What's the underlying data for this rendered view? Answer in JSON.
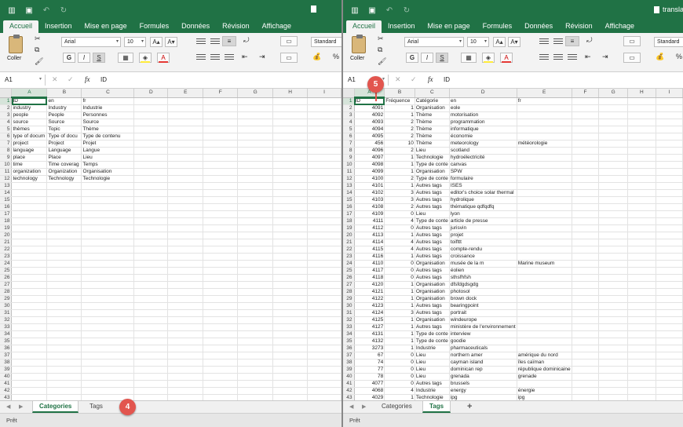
{
  "left": {
    "title": "",
    "tabs": [
      "Accueil",
      "Insertion",
      "Mise en page",
      "Formules",
      "Données",
      "Révision",
      "Affichage"
    ],
    "ribbon": {
      "paste_label": "Coller",
      "font": "Arial",
      "size": "10",
      "bold": "G",
      "italic": "I",
      "underline": "S"
    },
    "namebox": "A1",
    "formula": "ID",
    "columns": [
      "A",
      "B",
      "C",
      "D",
      "E",
      "F",
      "G",
      "H",
      "I"
    ],
    "rows": [
      [
        "ID",
        "en",
        "fr"
      ],
      [
        "industry",
        "Industry",
        "Industrie"
      ],
      [
        "people",
        "People",
        "Personnes"
      ],
      [
        "source",
        "Source",
        "Source"
      ],
      [
        "thèmes",
        "Topic",
        "Thème"
      ],
      [
        "type of docum",
        "Type of docu",
        "Type de contenu"
      ],
      [
        "project",
        "Project",
        "Projet"
      ],
      [
        "language",
        "Language",
        "Langue"
      ],
      [
        "place",
        "Place",
        "Lieu"
      ],
      [
        "time",
        "Time coverag",
        "Temps"
      ],
      [
        "organization",
        "Organization",
        "Organisation"
      ],
      [
        "technology",
        "Technology",
        "Technologie"
      ]
    ],
    "sheets": [
      "Categories",
      "Tags"
    ],
    "active_sheet": 0,
    "status": "Prêt",
    "callout": "4"
  },
  "right": {
    "title": "transla",
    "tabs": [
      "Accueil",
      "Insertion",
      "Mise en page",
      "Formules",
      "Données",
      "Révision",
      "Affichage"
    ],
    "ribbon": {
      "paste_label": "Coller",
      "font": "Arial",
      "size": "10",
      "bold": "G",
      "italic": "I",
      "underline": "S",
      "number_format": "Standard"
    },
    "namebox": "A1",
    "formula": "ID",
    "columns": [
      "A",
      "B",
      "C",
      "D",
      "E",
      "F",
      "G",
      "H",
      "I"
    ],
    "rows": [
      [
        "ID",
        "Fréquence",
        "Catégorie",
        "en",
        "fr"
      ],
      [
        "4091",
        "1",
        "Organisation",
        "eole",
        ""
      ],
      [
        "4092",
        "1",
        "Thème",
        "motorisation",
        ""
      ],
      [
        "4093",
        "2",
        "Thème",
        "programmation",
        ""
      ],
      [
        "4094",
        "2",
        "Thème",
        "informatique",
        ""
      ],
      [
        "4095",
        "2",
        "Thème",
        "économie",
        ""
      ],
      [
        "456",
        "10",
        "Thème",
        "meteorology",
        "météorologie"
      ],
      [
        "4096",
        "2",
        "Lieu",
        "scotland",
        ""
      ],
      [
        "4097",
        "1",
        "Technologie",
        "hydroélectricité",
        ""
      ],
      [
        "4098",
        "1",
        "Type de conte",
        "canvas",
        ""
      ],
      [
        "4099",
        "1",
        "Organisation",
        "SPW",
        ""
      ],
      [
        "4100",
        "2",
        "Type de conte",
        "formulaire",
        ""
      ],
      [
        "4101",
        "1",
        "Autres tags",
        "ISES",
        ""
      ],
      [
        "4102",
        "3",
        "Autres tags",
        "editor's choice solar thermal",
        ""
      ],
      [
        "4103",
        "3",
        "Autres tags",
        "hydrolique",
        ""
      ],
      [
        "4108",
        "2",
        "Autres tags",
        "thématique qdfqdfq",
        ""
      ],
      [
        "4109",
        "0",
        "Lieu",
        "lyon",
        ""
      ],
      [
        "4111",
        "4",
        "Type de conte",
        "article de presse",
        ""
      ],
      [
        "4112",
        "0",
        "Autres tags",
        "jurisvin",
        ""
      ],
      [
        "4113",
        "1",
        "Autres tags",
        "projet",
        ""
      ],
      [
        "4114",
        "4",
        "Autres tags",
        "toifttt",
        ""
      ],
      [
        "4115",
        "4",
        "Autres tags",
        "compte-rendu",
        ""
      ],
      [
        "4116",
        "1",
        "Autres tags",
        "croissance",
        ""
      ],
      [
        "4110",
        "0",
        "Organisation",
        "musée de la m",
        "Marine museum"
      ],
      [
        "4117",
        "0",
        "Autres tags",
        "éolien",
        ""
      ],
      [
        "4118",
        "0",
        "Autres tags",
        "sthsfhfsh",
        ""
      ],
      [
        "4120",
        "1",
        "Organisation",
        "dfsfdgdsgdg",
        ""
      ],
      [
        "4121",
        "1",
        "Organisation",
        "photosol",
        ""
      ],
      [
        "4122",
        "1",
        "Organisation",
        "brown dock",
        ""
      ],
      [
        "4123",
        "1",
        "Autres tags",
        "bearingpoint",
        ""
      ],
      [
        "4124",
        "3",
        "Autres tags",
        "portrait",
        ""
      ],
      [
        "4125",
        "1",
        "Organisation",
        "windeurope",
        ""
      ],
      [
        "4127",
        "1",
        "Autres tags",
        "ministère de l'environnement",
        ""
      ],
      [
        "4131",
        "1",
        "Type de conte",
        "interview",
        ""
      ],
      [
        "4132",
        "1",
        "Type de conte",
        "goodie",
        ""
      ],
      [
        "3273",
        "1",
        "Industrie",
        "pharmaceuticals",
        ""
      ],
      [
        "67",
        "0",
        "Lieu",
        "northern amer",
        "amérique du nord"
      ],
      [
        "74",
        "0",
        "Lieu",
        "cayman island",
        "îles caïman"
      ],
      [
        "77",
        "0",
        "Lieu",
        "dominican rep",
        "république dominicaine"
      ],
      [
        "78",
        "0",
        "Lieu",
        "grenada",
        "grenade"
      ],
      [
        "4077",
        "0",
        "Autres tags",
        "brussels",
        ""
      ],
      [
        "4068",
        "4",
        "Industrie",
        "energy",
        "énergie"
      ],
      [
        "4029",
        "1",
        "Technologie",
        "ipg",
        "ipg"
      ],
      [
        "3453",
        "1",
        "Autres tags",
        "london",
        ""
      ]
    ],
    "sheets": [
      "Categories",
      "Tags"
    ],
    "active_sheet": 1,
    "add_sheet": "+",
    "status": "Prêt",
    "callout": "5"
  },
  "colors": {
    "excel_green": "#207245",
    "callout": "#e2554e"
  },
  "icons": [
    "sidebar-icon",
    "save-icon",
    "undo-icon",
    "redo-icon",
    "file-icon",
    "cut-icon",
    "copy-icon",
    "format-painter-icon",
    "grow-font-icon",
    "shrink-font-icon",
    "borders-icon",
    "fill-color-icon",
    "font-color-icon",
    "align-icon",
    "wrap-icon",
    "indent-icon",
    "merge-icon"
  ]
}
